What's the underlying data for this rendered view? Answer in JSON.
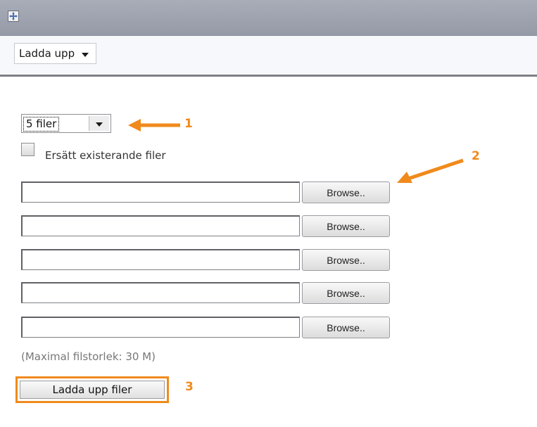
{
  "header": {
    "maximize_icon": "maximize-icon"
  },
  "toolbar": {
    "upload_menu_label": "Ladda upp"
  },
  "form": {
    "file_count_selected": "5 filer",
    "replace_existing_label": "Ersätt existerande filer",
    "replace_existing_checked": false,
    "file_rows": [
      {
        "value": "",
        "browse_label": "Browse.."
      },
      {
        "value": "",
        "browse_label": "Browse.."
      },
      {
        "value": "",
        "browse_label": "Browse.."
      },
      {
        "value": "",
        "browse_label": "Browse.."
      },
      {
        "value": "",
        "browse_label": "Browse.."
      }
    ],
    "max_size_note": "(Maximal filstorlek: 30 M)",
    "upload_button_label": "Ladda upp filer"
  },
  "annotations": {
    "label_1": "1",
    "label_2": "2",
    "label_3": "3",
    "color": "#f08a1c"
  }
}
